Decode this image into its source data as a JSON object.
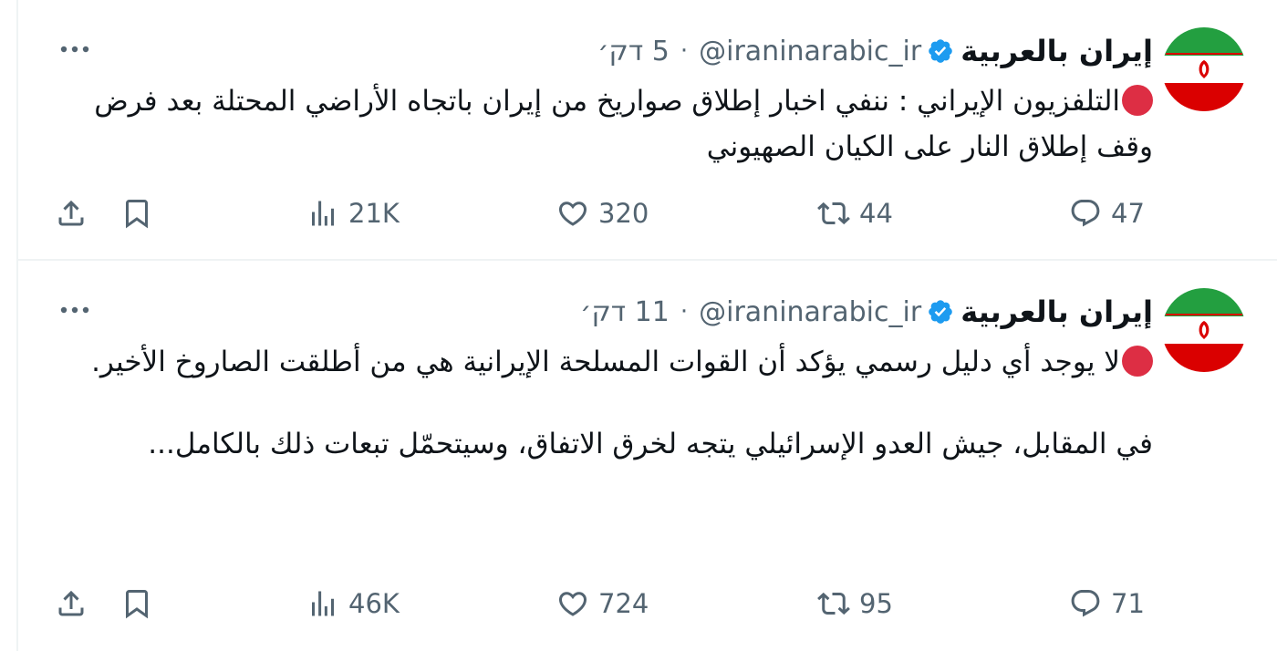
{
  "tweets": [
    {
      "name": "إيران بالعربية",
      "handle": "@iraninarabic_ir",
      "separator": "·",
      "time": "5 דק׳",
      "paragraphs": [
        "التلفزيون الإيراني : ننفي اخبار إطلاق صواريخ من إيران باتجاه الأراضي المحتلة بعد فرض وقف إطلاق النار على الكيان الصهيوني"
      ],
      "stats": {
        "replies": "47",
        "retweets": "44",
        "likes": "320",
        "views": "21K"
      }
    },
    {
      "name": "إيران بالعربية",
      "handle": "@iraninarabic_ir",
      "separator": "·",
      "time": "11 דק׳",
      "paragraphs": [
        "لا يوجد أي دليل رسمي يؤكد أن القوات المسلحة الإيرانية هي من أطلقت الصاروخ الأخير.",
        "في المقابل، جيش العدو الإسرائيلي يتجه لخرق الاتفاق، وسيتحمّل تبعات ذلك بالكامل..."
      ],
      "stats": {
        "replies": "71",
        "retweets": "95",
        "likes": "724",
        "views": "46K"
      }
    }
  ],
  "icons": {
    "verified": "verified-badge-icon",
    "more": "more-icon",
    "reply": "reply-icon",
    "retweet": "retweet-icon",
    "like": "like-icon",
    "views": "views-icon",
    "bookmark": "bookmark-icon",
    "share": "share-icon",
    "emoji": "red-circle-emoji"
  },
  "colors": {
    "verified": "#1d9bf0",
    "secondary_text": "#536471",
    "red_circle": "#dd2e44",
    "flag_green": "#239f40",
    "flag_red": "#da0000"
  }
}
